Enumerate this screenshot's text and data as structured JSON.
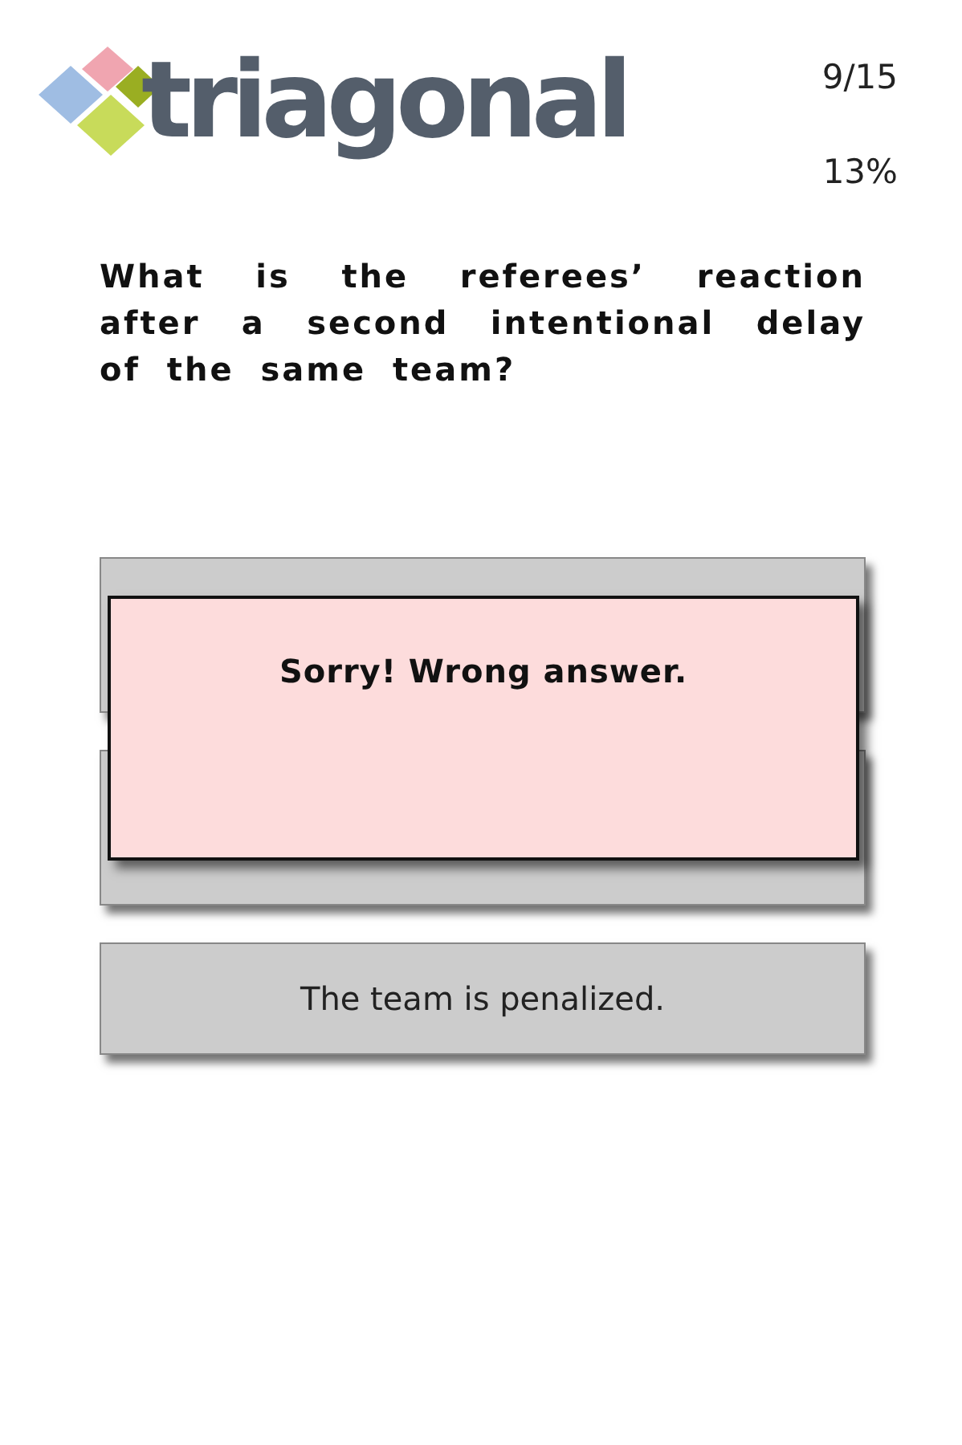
{
  "logo": "triagonal",
  "progress": {
    "count": "9/15",
    "percent": "13%"
  },
  "question": "What is the referees’ reaction after a second intentional delay of the same team?",
  "answers": [
    {
      "kind": "covered"
    },
    {
      "kind": "covered"
    },
    {
      "kind": "open",
      "label": "The team is penalized."
    }
  ],
  "feedback": {
    "message": "Sorry! Wrong answer."
  }
}
